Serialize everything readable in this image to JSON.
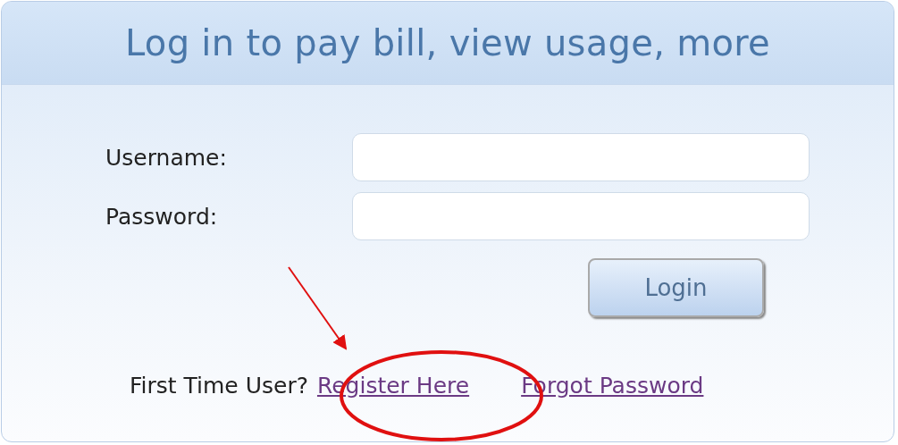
{
  "panel": {
    "title": "Log in to pay bill, view usage, more"
  },
  "fields": [
    {
      "label": "Username:"
    },
    {
      "label": "Password:"
    }
  ],
  "login_button": "Login",
  "footer": {
    "prompt": "First Time User?",
    "links": [
      "Register Here",
      "Forgot Password"
    ]
  }
}
